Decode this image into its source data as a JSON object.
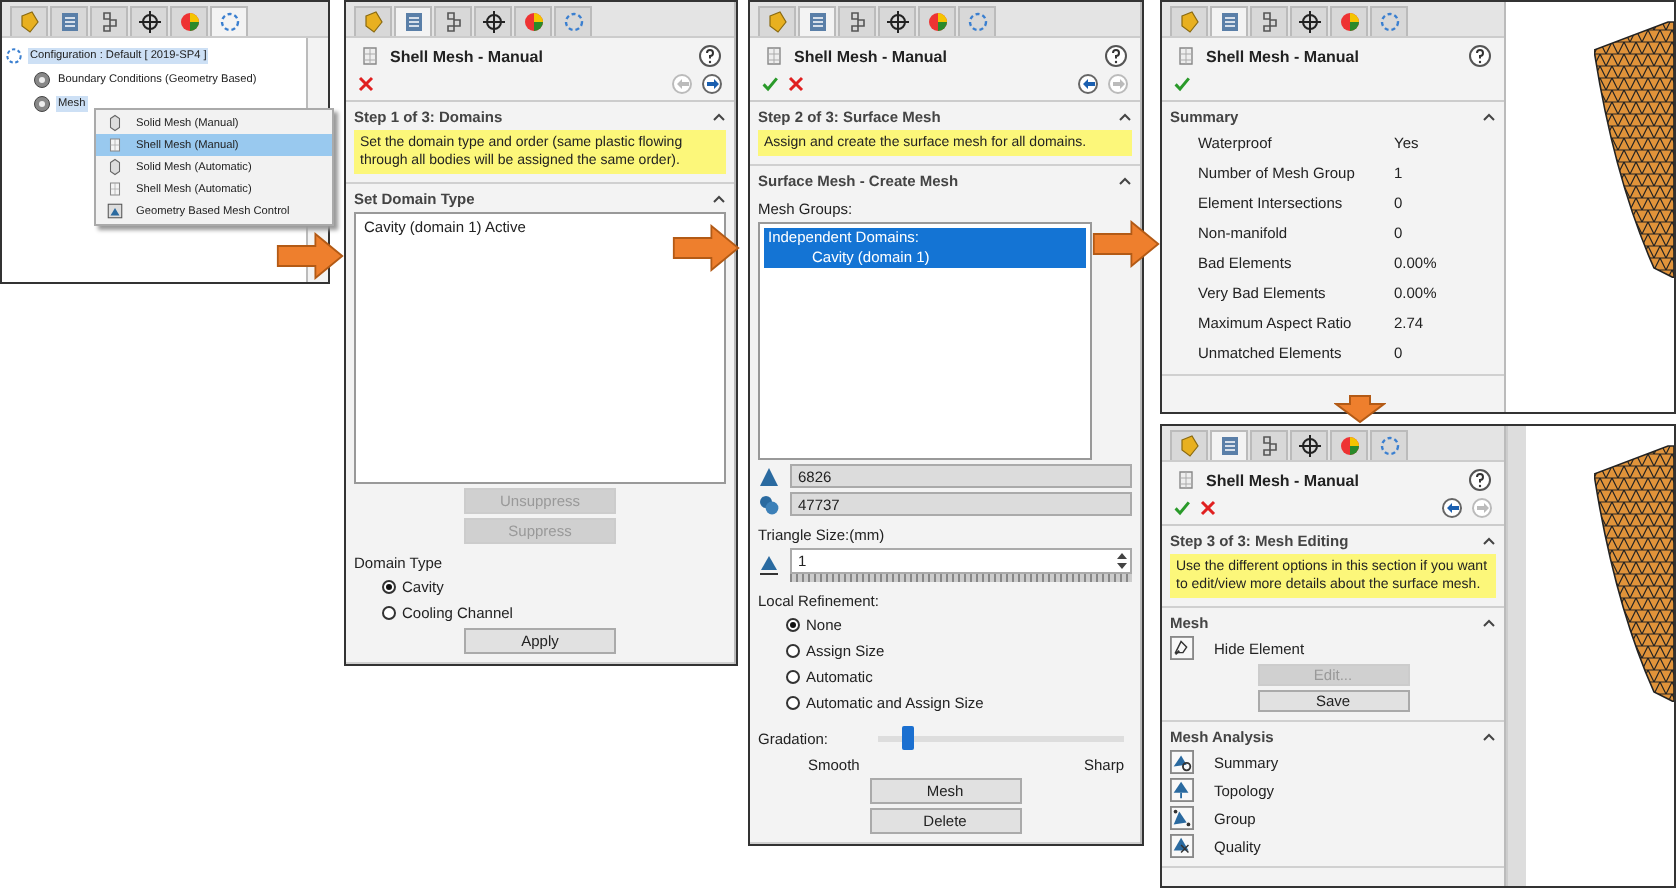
{
  "tree_panel": {
    "tabs": [
      {
        "selected": false
      },
      {
        "selected": false
      },
      {
        "selected": false
      },
      {
        "selected": false
      },
      {
        "selected": false
      },
      {
        "selected": true
      }
    ],
    "tree": [
      {
        "label": "Configuration : Default [ 2019-SP4 ]",
        "selected": true,
        "children": [
          {
            "label": "Boundary Conditions (Geometry Based)",
            "selected": false
          },
          {
            "label": "Mesh",
            "selected": true
          }
        ]
      }
    ],
    "context_menu": [
      {
        "kind": "solid",
        "label": "Solid Mesh (Manual)",
        "selected": false
      },
      {
        "kind": "shell",
        "label": "Shell Mesh (Manual)",
        "selected": true
      },
      {
        "kind": "solid",
        "label": "Solid Mesh (Automatic)",
        "selected": false
      },
      {
        "kind": "shell",
        "label": "Shell Mesh (Automatic)",
        "selected": false
      },
      {
        "kind": "control",
        "label": "Geometry Based Mesh Control",
        "selected": false
      }
    ]
  },
  "panels": [
    {
      "tabs": [
        {
          "selected": false
        },
        {
          "selected": true
        },
        {
          "selected": false
        },
        {
          "selected": false
        },
        {
          "selected": false
        },
        {
          "selected": false
        }
      ],
      "title": "Shell Mesh - Manual",
      "actions": [
        {
          "kind": "cancel"
        }
      ],
      "nav": [
        {
          "kind": "back",
          "disabled": true
        },
        {
          "kind": "next",
          "disabled": false
        }
      ],
      "sections": [
        {
          "title": "Step 1 of 3: Domains",
          "expanded": true,
          "items": [
            {
              "kind": "note",
              "text": "Set the domain type and order (same plastic flowing through all bodies will be assigned the same order)."
            }
          ]
        },
        {
          "title": "Set Domain Type",
          "expanded": true,
          "items": [
            {
              "kind": "list",
              "items": [
                {
                  "label": "Cavity (domain 1) Active",
                  "selected": false
                }
              ]
            },
            {
              "kind": "button",
              "label": "Unsuppress",
              "disabled": true
            },
            {
              "kind": "button",
              "label": "Suppress",
              "disabled": true
            },
            {
              "kind": "label",
              "text": "Domain Type"
            },
            {
              "kind": "radio",
              "label": "Cavity",
              "selected": true
            },
            {
              "kind": "radio",
              "label": "Cooling Channel",
              "selected": false
            },
            {
              "kind": "button",
              "label": "Apply",
              "disabled": false
            }
          ]
        }
      ]
    },
    {
      "tabs": [
        {
          "selected": false
        },
        {
          "selected": true
        },
        {
          "selected": false
        },
        {
          "selected": false
        },
        {
          "selected": false
        },
        {
          "selected": false
        }
      ],
      "title": "Shell Mesh - Manual",
      "actions": [
        {
          "kind": "ok"
        },
        {
          "kind": "cancel"
        }
      ],
      "nav": [
        {
          "kind": "back",
          "disabled": false
        },
        {
          "kind": "next",
          "disabled": true
        }
      ],
      "sections": [
        {
          "title": "Step 2 of 3: Surface Mesh",
          "expanded": true,
          "items": [
            {
              "kind": "note",
              "text": "Assign and create the surface mesh for all domains."
            }
          ]
        },
        {
          "title": "Surface Mesh - Create Mesh",
          "expanded": true,
          "items": [
            {
              "kind": "label",
              "text": "Mesh Groups:"
            },
            {
              "kind": "list",
              "items": [
                {
                  "label": "Independent Domains:",
                  "selected": true,
                  "children": [
                    {
                      "label": "Cavity (domain 1)",
                      "selected": true
                    }
                  ]
                }
              ]
            },
            {
              "kind": "field",
              "value": "6826",
              "disabled": true
            },
            {
              "kind": "field",
              "value": "47737",
              "disabled": true
            },
            {
              "kind": "label",
              "text": "Triangle Size:(mm)"
            },
            {
              "kind": "spin",
              "value": "1"
            },
            {
              "kind": "label",
              "text": "Local Refinement:"
            },
            {
              "kind": "radio",
              "label": "None",
              "selected": true
            },
            {
              "kind": "radio",
              "label": "Assign Size",
              "selected": false
            },
            {
              "kind": "radio",
              "label": "Automatic",
              "selected": false
            },
            {
              "kind": "radio",
              "label": "Automatic and Assign Size",
              "selected": false
            },
            {
              "kind": "slider",
              "label": "Gradation:",
              "level": 0.12,
              "min_label": "Smooth",
              "max_label": "Sharp"
            },
            {
              "kind": "button",
              "label": "Mesh",
              "disabled": false
            },
            {
              "kind": "button",
              "label": "Delete",
              "disabled": false
            }
          ]
        }
      ]
    },
    {
      "tabs": [
        {
          "selected": false
        },
        {
          "selected": true
        },
        {
          "selected": false
        },
        {
          "selected": false
        },
        {
          "selected": false
        },
        {
          "selected": false
        }
      ],
      "title": "Shell Mesh - Manual",
      "actions": [
        {
          "kind": "ok"
        }
      ],
      "sections": [
        {
          "title": "Summary",
          "expanded": true,
          "items": [
            {
              "kind": "stat",
              "label": "Waterproof",
              "value": "Yes"
            },
            {
              "kind": "stat",
              "label": "Number of Mesh Group",
              "value": "1"
            },
            {
              "kind": "stat",
              "label": "Element Intersections",
              "value": "0"
            },
            {
              "kind": "stat",
              "label": "Non-manifold",
              "value": "0"
            },
            {
              "kind": "stat",
              "label": "Bad Elements",
              "value": "0.00%"
            },
            {
              "kind": "stat",
              "label": "Very Bad Elements",
              "value": "0.00%"
            },
            {
              "kind": "stat",
              "label": "Maximum Aspect Ratio",
              "value": "2.74"
            },
            {
              "kind": "stat",
              "label": "Unmatched Elements",
              "value": "0"
            }
          ]
        }
      ]
    },
    {
      "tabs": [
        {
          "selected": false
        },
        {
          "selected": true
        },
        {
          "selected": false
        },
        {
          "selected": false
        },
        {
          "selected": false
        },
        {
          "selected": false
        }
      ],
      "title": "Shell Mesh - Manual",
      "actions": [
        {
          "kind": "ok"
        },
        {
          "kind": "cancel"
        }
      ],
      "nav": [
        {
          "kind": "back",
          "disabled": false
        },
        {
          "kind": "next",
          "disabled": true
        }
      ],
      "sections": [
        {
          "title": "Step 3 of 3: Mesh Editing",
          "expanded": true,
          "items": [
            {
              "kind": "note",
              "text": "Use the different options in this section if you want to edit/view more details about the surface mesh."
            }
          ]
        },
        {
          "title": "Mesh",
          "expanded": true,
          "items": [
            {
              "kind": "tool",
              "label": "Hide Element"
            },
            {
              "kind": "button",
              "label": "Edit...",
              "disabled": true
            },
            {
              "kind": "button",
              "label": "Save",
              "disabled": false
            }
          ]
        },
        {
          "title": "Mesh Analysis",
          "expanded": true,
          "items": [
            {
              "kind": "tool",
              "label": "Summary"
            },
            {
              "kind": "tool",
              "label": "Topology"
            },
            {
              "kind": "tool",
              "label": "Group"
            },
            {
              "kind": "tool",
              "label": "Quality"
            }
          ]
        }
      ]
    }
  ]
}
